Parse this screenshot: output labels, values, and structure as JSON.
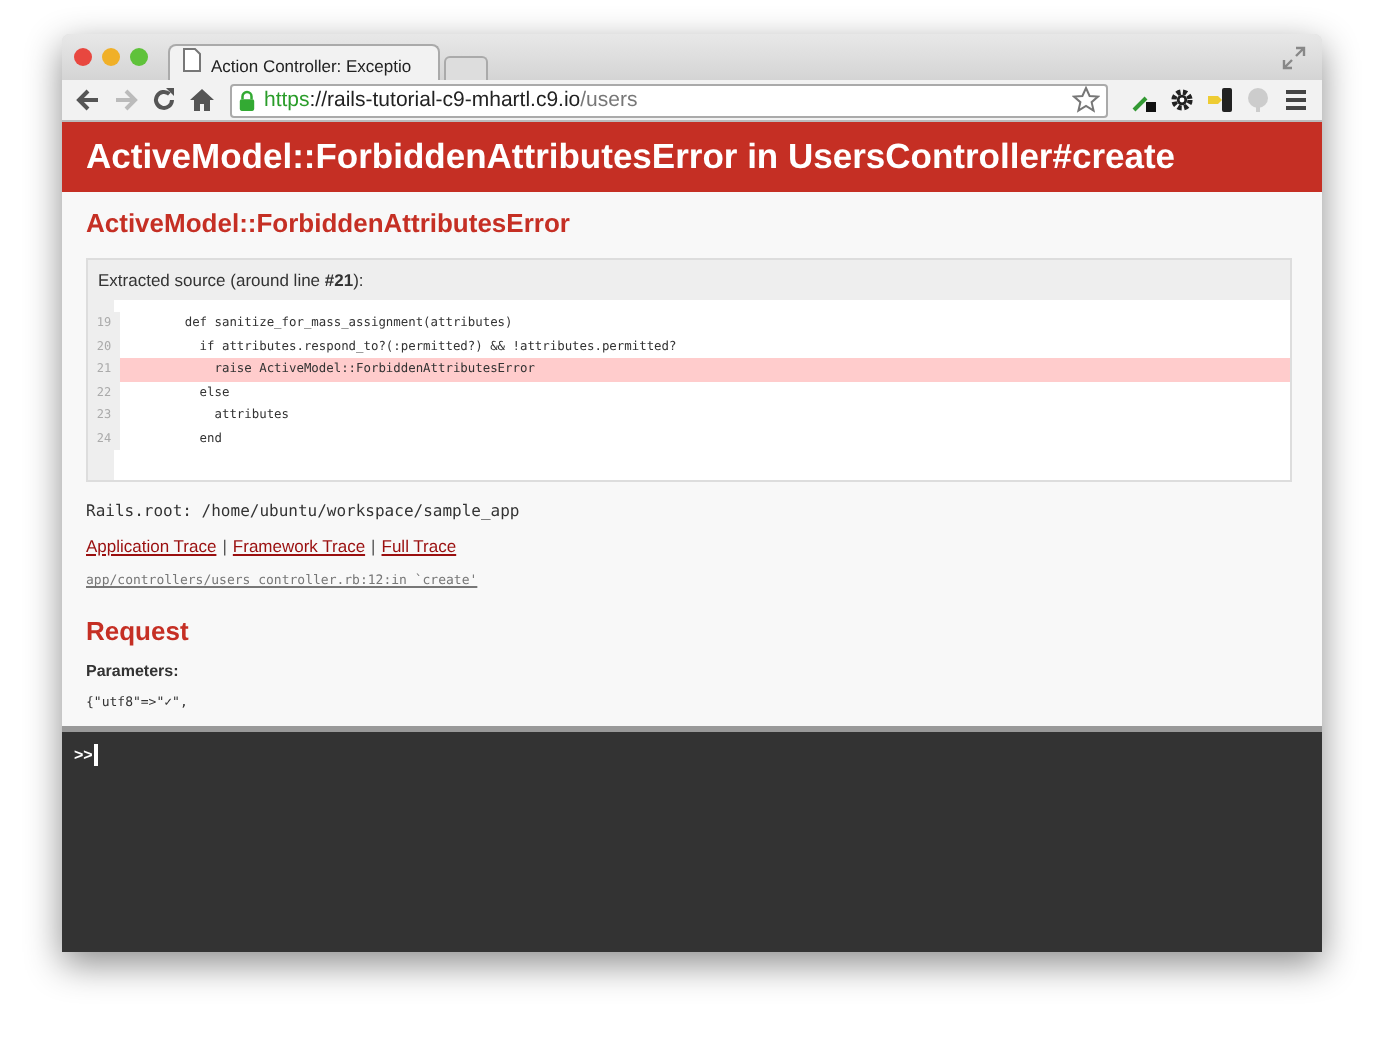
{
  "browser": {
    "tab_title": "Action Controller: Exceptio",
    "url_scheme": "https",
    "url_host": "://rails-tutorial-c9-mhartl.c9.io",
    "url_path": "/users"
  },
  "header": {
    "title": "ActiveModel::ForbiddenAttributesError in UsersController#create"
  },
  "error_title": "ActiveModel::ForbiddenAttributesError",
  "source": {
    "caption": "Extracted source (around line **#21**):",
    "lines": [
      {
        "number": "19",
        "code": "      def sanitize_for_mass_assignment(attributes)",
        "highlighted": false
      },
      {
        "number": "20",
        "code": "        if attributes.respond_to?(:permitted?) && !attributes.permitted?",
        "highlighted": false
      },
      {
        "number": "21",
        "code": "          raise ActiveModel::ForbiddenAttributesError",
        "highlighted": true
      },
      {
        "number": "22",
        "code": "        else",
        "highlighted": false
      },
      {
        "number": "23",
        "code": "          attributes",
        "highlighted": false
      },
      {
        "number": "24",
        "code": "        end",
        "highlighted": false
      }
    ]
  },
  "rails_root": "Rails.root: /home/ubuntu/workspace/sample_app",
  "traces": [
    {
      "label": "Application Trace"
    },
    {
      "label": "Framework Trace"
    },
    {
      "label": "Full Trace"
    }
  ],
  "trace_separator": "|",
  "trace_line": "app/controllers/users_controller.rb:12:in `create'",
  "request": {
    "heading": "Request",
    "parameters_label": "Parameters:",
    "parameters": "{\"utf8\"=>\"✓\","
  },
  "console": {
    "prompt": ">>"
  }
}
